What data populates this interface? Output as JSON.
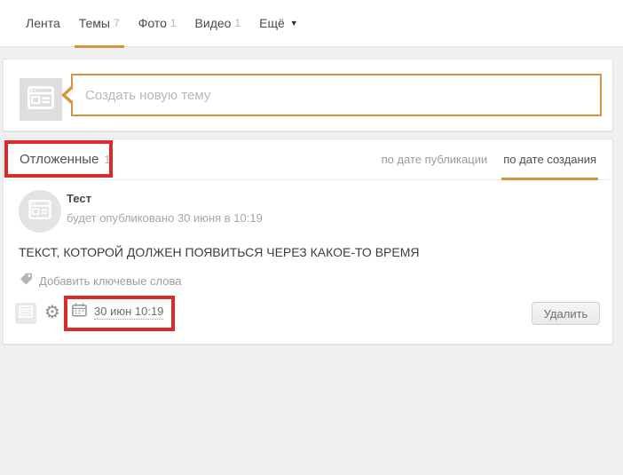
{
  "colors": {
    "accent": "#d2973c",
    "annotation_red": "#dc2a2a",
    "page_background": "#f0f0f0",
    "card_background": "#ffffff"
  },
  "nav": {
    "items": [
      {
        "label": "Лента"
      },
      {
        "label": "Темы",
        "count": "7",
        "active": true
      },
      {
        "label": "Фото",
        "count": "1"
      },
      {
        "label": "Видео",
        "count": "1"
      },
      {
        "label": "Ещё",
        "caret": "▼"
      }
    ]
  },
  "composer": {
    "placeholder": "Создать новую тему",
    "value": ""
  },
  "feed": {
    "title": "Отложенные",
    "count": "1",
    "tabs": [
      {
        "label": "по дате публикации"
      },
      {
        "label": "по дате создания",
        "active": true
      }
    ],
    "post": {
      "author": "Тест",
      "status": "будет опубликовано 30 июня в 10:19",
      "body": "ТЕКСТ, КОТОРОЙ ДОЛЖЕН ПОЯВИТЬСЯ ЧЕРЕЗ КАКОЕ-ТО ВРЕМЯ",
      "keywords_link": "Добавить ключевые слова",
      "schedule": "30 июн 10:19",
      "delete_label": "Удалить"
    }
  },
  "icons": {
    "gear": "⚙",
    "more_caret": "▼"
  }
}
